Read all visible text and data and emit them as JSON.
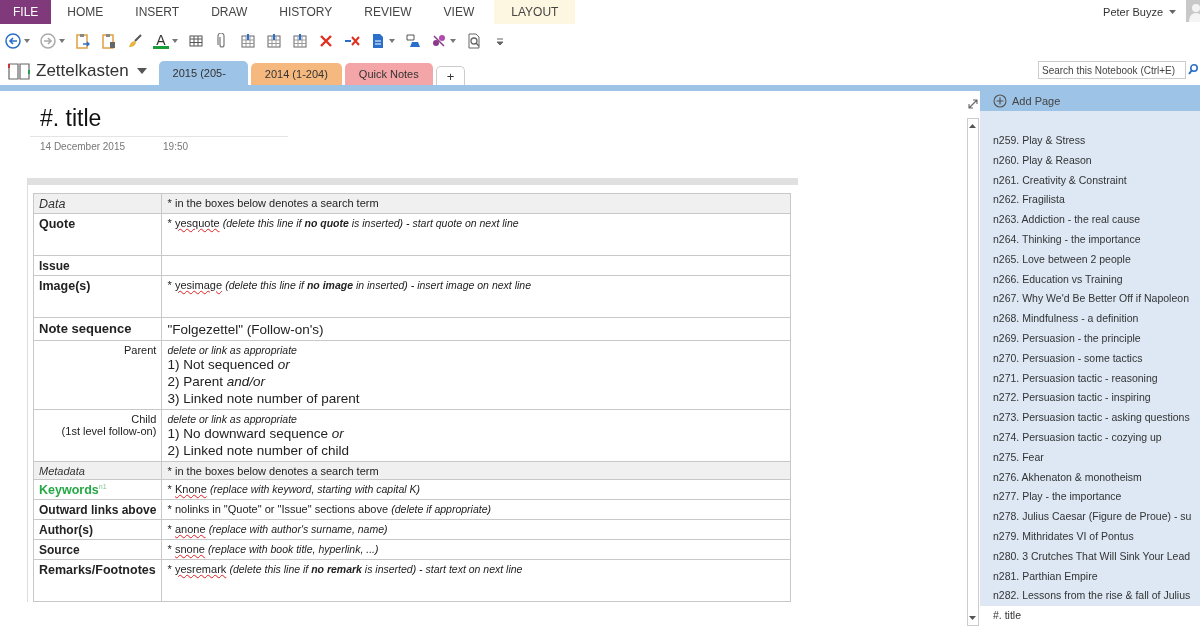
{
  "ribbon": {
    "tabs": [
      {
        "label": "FILE",
        "kind": "file"
      },
      {
        "label": "HOME",
        "kind": "normal"
      },
      {
        "label": "INSERT",
        "kind": "normal"
      },
      {
        "label": "DRAW",
        "kind": "normal"
      },
      {
        "label": "HISTORY",
        "kind": "normal"
      },
      {
        "label": "REVIEW",
        "kind": "normal"
      },
      {
        "label": "VIEW",
        "kind": "normal"
      },
      {
        "label": "LAYOUT",
        "kind": "contextual"
      }
    ],
    "user": "Peter Buyze"
  },
  "toolbar": {
    "font_color_glyph": "A"
  },
  "notebook": {
    "name": "Zettelkasten",
    "sections": [
      {
        "label": "2015 (205-",
        "color": "#9dc3e6",
        "selected": true
      },
      {
        "label": "2014 (1-204)",
        "color": "#f5b97f",
        "selected": false
      },
      {
        "label": "Quick Notes",
        "color": "#f4a5a8",
        "selected": false
      }
    ],
    "add_section": "+",
    "search": {
      "placeholder": "Search this Notebook (Ctrl+E)"
    }
  },
  "page": {
    "title": "#. title",
    "date": "14 December 2015",
    "time": "19:50",
    "table": {
      "rows": [
        {
          "kind": "section",
          "label": [
            "Data"
          ],
          "marker": "*",
          "text": "in the boxes below denotes a search term"
        },
        {
          "kind": "entry",
          "label": [
            "Quote"
          ],
          "marker": "*",
          "term": "yesquote",
          "hint": "(delete this line if **no quote** is inserted) - start quote on next line"
        },
        {
          "kind": "field",
          "label": [
            "Issue"
          ]
        },
        {
          "kind": "entry",
          "label": [
            "Image(s)"
          ],
          "marker": "*",
          "term": "yesimage",
          "hint": "(delete this line if **no image** in inserted) - insert image on next line"
        },
        {
          "kind": "heading",
          "label": [
            "Note sequence"
          ],
          "lines": [
            "\"Folgezettel\" (Follow-on's)"
          ]
        },
        {
          "kind": "sub",
          "label": [
            "Parent"
          ],
          "note": "delete or link as appropriate",
          "lines": [
            "1) Not sequenced *or*",
            "2) Parent *and/or*",
            "3) Linked note number of parent"
          ]
        },
        {
          "kind": "sub",
          "label": [
            "Child",
            "(1st level follow-on)"
          ],
          "note": "delete or link as appropriate",
          "lines": [
            "1) No downward sequence *or*",
            "2) Linked note number of child"
          ]
        },
        {
          "kind": "section",
          "label": [
            "Metadata"
          ],
          "marker": "*",
          "text": "in the boxes below denotes a search term"
        },
        {
          "kind": "keyword",
          "label": [
            "Keywords$^{n1}$"
          ],
          "marker": "*",
          "term": "Knone",
          "hint": "(replace with keyword, starting with capital K)"
        },
        {
          "kind": "field",
          "label": [
            "Outward links above"
          ],
          "marker": "*",
          "text": "nolinks in \"Quote\" or \"Issue\" sections above",
          "hint": "(delete if appropriate)"
        },
        {
          "kind": "field",
          "label": [
            "Author(s)"
          ],
          "marker": "*",
          "term": "anone",
          "hint": "(replace with author's surname, name)"
        },
        {
          "kind": "field",
          "label": [
            "Source"
          ],
          "marker": "*",
          "term": "snone",
          "hint": "(replace with book title, hyperlink, ...)"
        },
        {
          "kind": "entry",
          "label": [
            "Remarks/Footnotes"
          ],
          "marker": "*",
          "term": "yesremark",
          "hint": "(delete this line if **no remark** is inserted) - start text on next line"
        }
      ]
    }
  },
  "pages_panel": {
    "add_page": "Add Page",
    "pages": [
      {
        "title": "n259. Play & Stress",
        "selected": false
      },
      {
        "title": "n260. Play & Reason",
        "selected": false
      },
      {
        "title": "n261. Creativity & Constraint",
        "selected": false
      },
      {
        "title": "n262. Fragilista",
        "selected": false
      },
      {
        "title": "n263. Addiction - the real cause",
        "selected": false
      },
      {
        "title": "n264. Thinking - the importance",
        "selected": false
      },
      {
        "title": "n265. Love between 2 people",
        "selected": false
      },
      {
        "title": "n266. Education vs Training",
        "selected": false
      },
      {
        "title": "n267. Why We'd Be Better Off if Napoleon",
        "selected": false
      },
      {
        "title": "n268. Mindfulness - a definition",
        "selected": false
      },
      {
        "title": "n269. Persuasion - the principle",
        "selected": false
      },
      {
        "title": "n270. Persuasion - some tactics",
        "selected": false
      },
      {
        "title": "n271. Persuasion tactic - reasoning",
        "selected": false
      },
      {
        "title": "n272. Persuasion tactic - inspiring",
        "selected": false
      },
      {
        "title": "n273. Persuasion tactic - asking questions",
        "selected": false
      },
      {
        "title": "n274. Persuasion tactic - cozying up",
        "selected": false
      },
      {
        "title": "n275. Fear",
        "selected": false
      },
      {
        "title": "n276. Akhenaton & monotheism",
        "selected": false
      },
      {
        "title": "n277. Play - the importance",
        "selected": false
      },
      {
        "title": "n278. Julius Caesar (Figure de Proue) - su",
        "selected": false
      },
      {
        "title": "n279. Mithridates VI of Pontus",
        "selected": false
      },
      {
        "title": "n280. 3 Crutches That Will Sink Your Lead",
        "selected": false
      },
      {
        "title": "n281. Parthian Empire",
        "selected": false
      },
      {
        "title": "n282. Lessons from the rise & fall of Julius",
        "selected": false
      },
      {
        "title": "#. title",
        "selected": true
      }
    ]
  }
}
